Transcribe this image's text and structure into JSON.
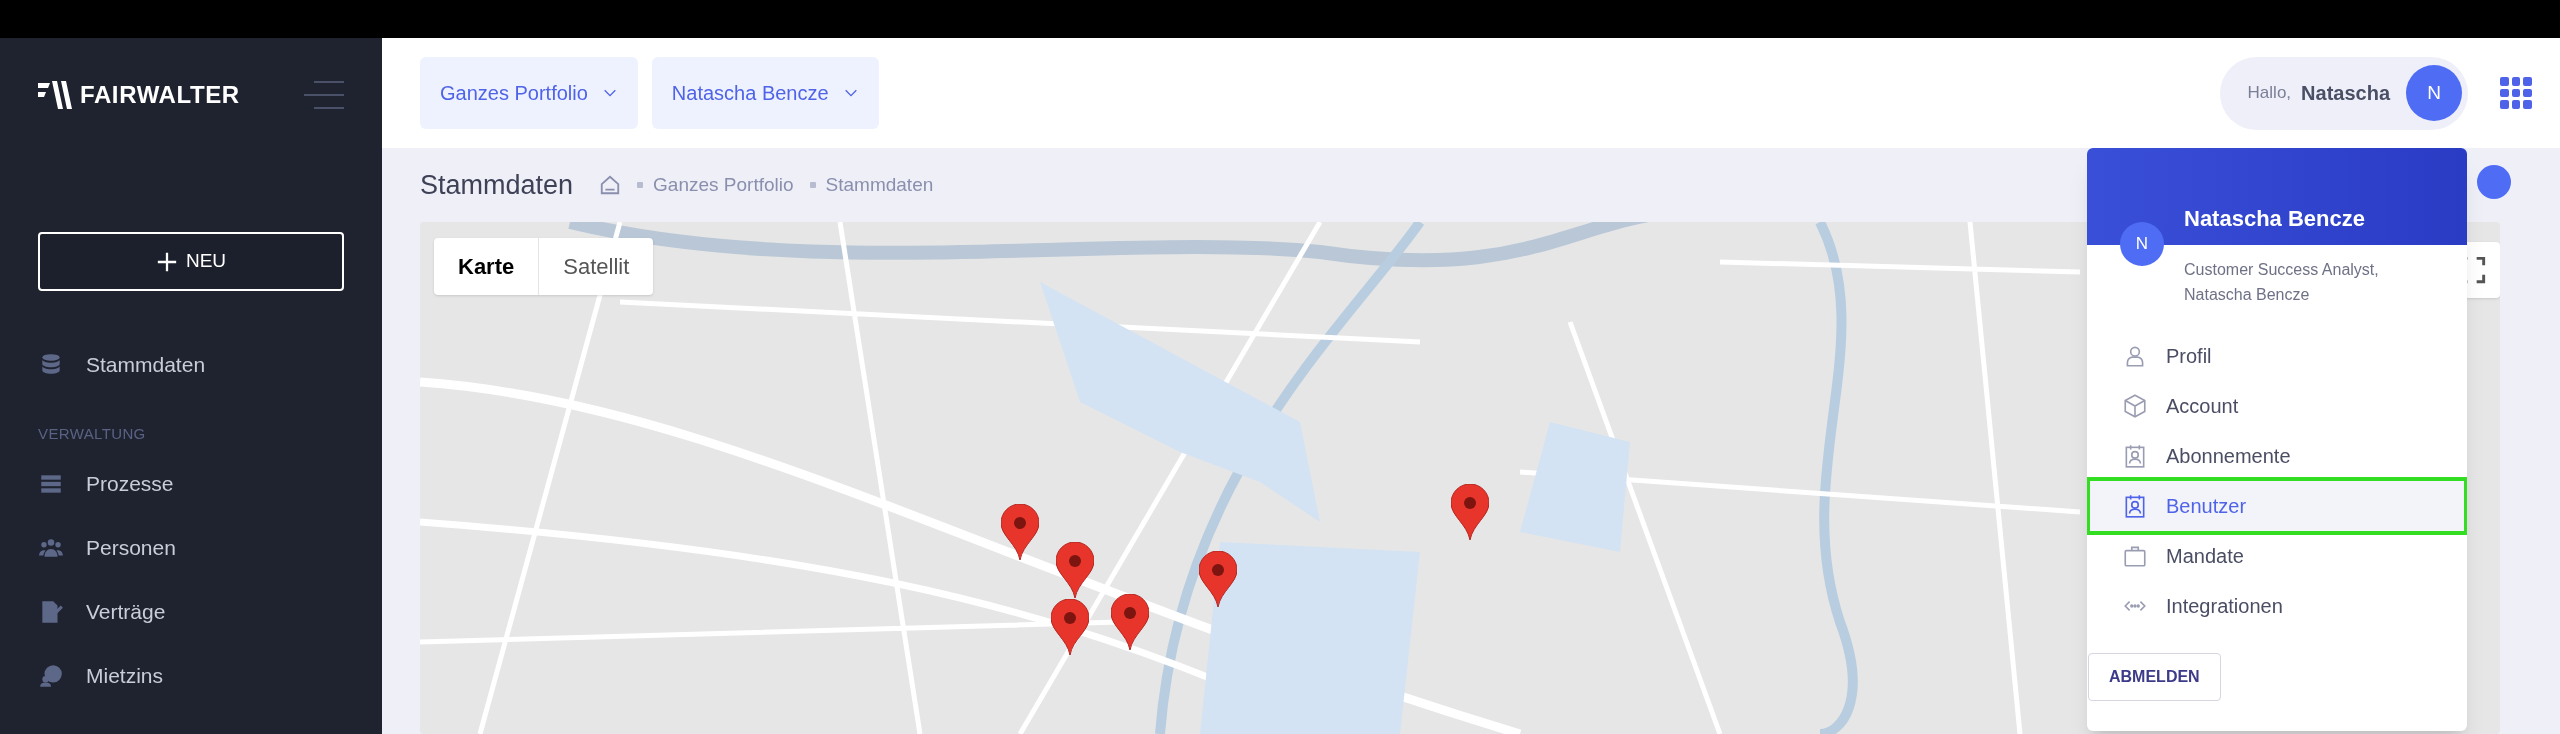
{
  "sidebar": {
    "logo": "FAIRWALTER",
    "new_button": "NEU",
    "items": [
      {
        "label": "Stammdaten"
      }
    ],
    "section": "VERWALTUNG",
    "section_items": [
      {
        "label": "Prozesse"
      },
      {
        "label": "Personen"
      },
      {
        "label": "Verträge"
      },
      {
        "label": "Mietzins"
      }
    ]
  },
  "header": {
    "filters": [
      "Ganzes Portfolio",
      "Natascha Bencze"
    ],
    "greeting": "Hallo,",
    "user_name": "Natascha",
    "avatar": "N"
  },
  "page": {
    "title": "Stammdaten",
    "breadcrumb": [
      "Ganzes Portfolio",
      "Stammdaten"
    ]
  },
  "map": {
    "tabs": [
      {
        "label": "Karte",
        "selected": true
      },
      {
        "label": "Satellit",
        "selected": false
      }
    ]
  },
  "user_menu": {
    "name": "Natascha Bencze",
    "avatar": "N",
    "role": "Customer Success Analyst, Natascha Bencze",
    "items": [
      {
        "label": "Profil",
        "hovered": false
      },
      {
        "label": "Account",
        "hovered": false
      },
      {
        "label": "Abonnemente",
        "hovered": false
      },
      {
        "label": "Benutzer",
        "hovered": true
      },
      {
        "label": "Mandate",
        "hovered": false
      },
      {
        "label": "Integrationen",
        "hovered": false
      }
    ],
    "logout": "ABMELDEN"
  }
}
